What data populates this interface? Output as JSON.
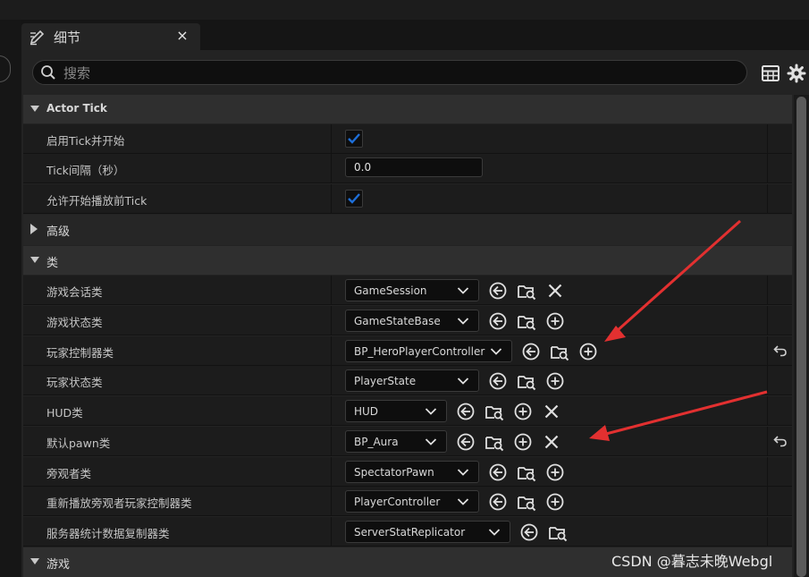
{
  "tab": {
    "title": "细节",
    "close": "×"
  },
  "search": {
    "placeholder": "搜索",
    "value": ""
  },
  "sections": {
    "actor_tick": "Actor Tick",
    "advanced": "高级",
    "classes": "类",
    "game": "游戏"
  },
  "actor_tick": {
    "start_with_tick": {
      "label": "启用Tick并开始",
      "checked": true
    },
    "tick_interval": {
      "label": "Tick间隔（秒）",
      "value": "0.0"
    },
    "tick_before_begin": {
      "label": "允许开始播放前Tick",
      "checked": true
    }
  },
  "classes": [
    {
      "label": "游戏会话类",
      "value": "GameSession",
      "third_action": "clear-icon",
      "modified": false
    },
    {
      "label": "游戏状态类",
      "value": "GameStateBase",
      "third_action": "add-icon",
      "modified": false
    },
    {
      "label": "玩家控制器类",
      "value": "BP_HeroPlayerController",
      "third_action": "add-icon",
      "modified": true
    },
    {
      "label": "玩家状态类",
      "value": "PlayerState",
      "third_action": "add-icon",
      "modified": false
    },
    {
      "label": "HUD类",
      "value": "HUD",
      "third_action": "add-icon",
      "modified": false,
      "fourth_action": "clear-icon"
    },
    {
      "label": "默认pawn类",
      "value": "BP_Aura",
      "third_action": "add-icon",
      "modified": true,
      "fourth_action": "clear-icon"
    },
    {
      "label": "旁观者类",
      "value": "SpectatorPawn",
      "third_action": "add-icon",
      "modified": false
    },
    {
      "label": "重新播放旁观者玩家控制器类",
      "value": "PlayerController",
      "third_action": "add-icon",
      "modified": false
    },
    {
      "label": "服务器统计数据复制器类",
      "value": "ServerStatReplicator",
      "third_action": "none",
      "modified": false
    }
  ],
  "colors": {
    "accent": "#1e6fd9",
    "annotation_arrow": "#e23030",
    "background": "#151515"
  },
  "watermark": "CSDN @暮志未晚Webgl"
}
